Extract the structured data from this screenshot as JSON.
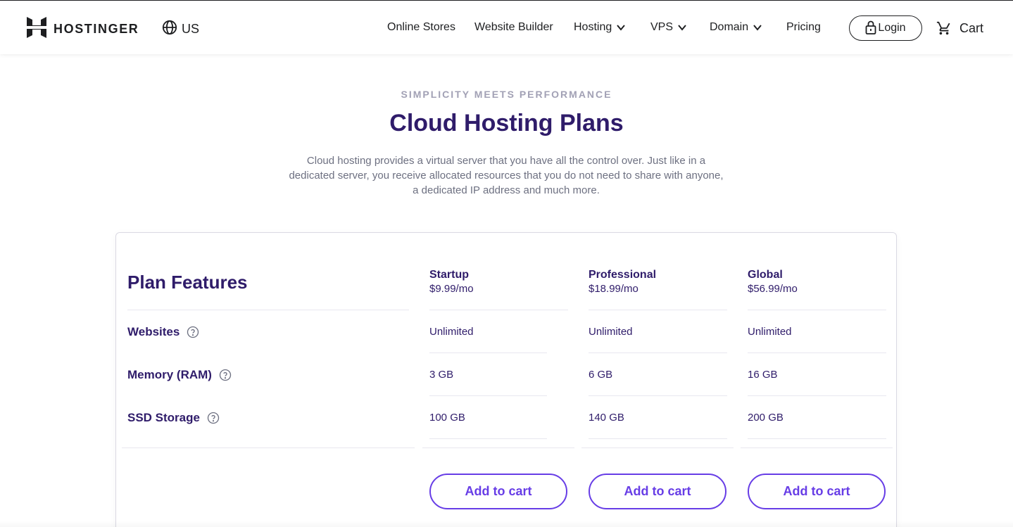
{
  "header": {
    "brand": "HOSTINGER",
    "locale": "US",
    "nav": [
      {
        "label": "Online Stores",
        "dropdown": false
      },
      {
        "label": "Website Builder",
        "dropdown": false
      },
      {
        "label": "Hosting",
        "dropdown": true
      },
      {
        "label": "VPS",
        "dropdown": true
      },
      {
        "label": "Domain",
        "dropdown": true
      },
      {
        "label": "Pricing",
        "dropdown": false
      }
    ],
    "login_label": "Login",
    "cart_label": "Cart"
  },
  "intro": {
    "eyebrow": "SIMPLICITY MEETS PERFORMANCE",
    "title": "Cloud Hosting Plans",
    "description": "Cloud hosting provides a virtual server that you have all the control over. Just like in a dedicated server, you receive allocated resources that you do not need to share with anyone, a dedicated IP address and much more."
  },
  "table": {
    "features_title": "Plan Features",
    "plans": [
      {
        "name": "Startup",
        "price": "$9.99/mo",
        "cta": "Add to cart"
      },
      {
        "name": "Professional",
        "price": "$18.99/mo",
        "cta": "Add to cart"
      },
      {
        "name": "Global",
        "price": "$56.99/mo",
        "cta": "Add to cart"
      }
    ],
    "rows": [
      {
        "label": "Websites",
        "values": [
          "Unlimited",
          "Unlimited",
          "Unlimited"
        ]
      },
      {
        "label": "Memory (RAM)",
        "values": [
          "3 GB",
          "6 GB",
          "16 GB"
        ]
      },
      {
        "label": "SSD Storage",
        "values": [
          "100 GB",
          "140 GB",
          "200 GB"
        ]
      }
    ]
  },
  "colors": {
    "primary_purple": "#673de6",
    "heading_navy": "#2f1c6a",
    "muted_gray": "#6d7081"
  },
  "icons": {
    "brand": "hostinger-logo-icon",
    "locale": "globe-icon",
    "dropdown": "chevron-down-icon",
    "login": "lock-icon",
    "cart": "cart-icon",
    "help": "help-circle-icon"
  }
}
